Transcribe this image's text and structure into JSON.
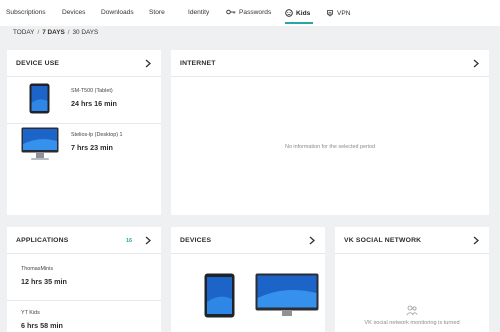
{
  "nav": {
    "items": [
      {
        "label": "Subscriptions"
      },
      {
        "label": "Devices"
      },
      {
        "label": "Downloads"
      },
      {
        "label": "Store"
      },
      {
        "label": "Identity"
      },
      {
        "label": "Passwords",
        "icon": "key-icon"
      },
      {
        "label": "Kids",
        "icon": "kids-face-icon",
        "active": true
      },
      {
        "label": "VPN",
        "icon": "vpn-shield-icon"
      }
    ],
    "accent": "#2aa6a6"
  },
  "period": {
    "options": [
      "TODAY",
      "7 DAYS",
      "30 DAYS"
    ],
    "separator": "/",
    "selected": "7 DAYS"
  },
  "device_use": {
    "title": "DEVICE USE",
    "devices": [
      {
        "name": "SM-T500 (Tablet)",
        "time": "24 hrs 16 min",
        "icon": "tablet-icon"
      },
      {
        "name": "Stelios-lp (Desktop) 1",
        "time": "7 hrs 23 min",
        "icon": "monitor-icon"
      }
    ]
  },
  "internet": {
    "title": "INTERNET",
    "empty_message": "No information for the selected period"
  },
  "applications": {
    "title": "APPLICATIONS",
    "count": "16",
    "apps": [
      {
        "name": "ThomasMinis",
        "time": "12 hrs 35 min"
      },
      {
        "name": "YT Kids",
        "time": "6 hrs 58 min"
      }
    ]
  },
  "devices": {
    "title": "DEVICES"
  },
  "vk": {
    "title": "VK SOCIAL NETWORK",
    "message": "VK social network monitoring is turned"
  }
}
